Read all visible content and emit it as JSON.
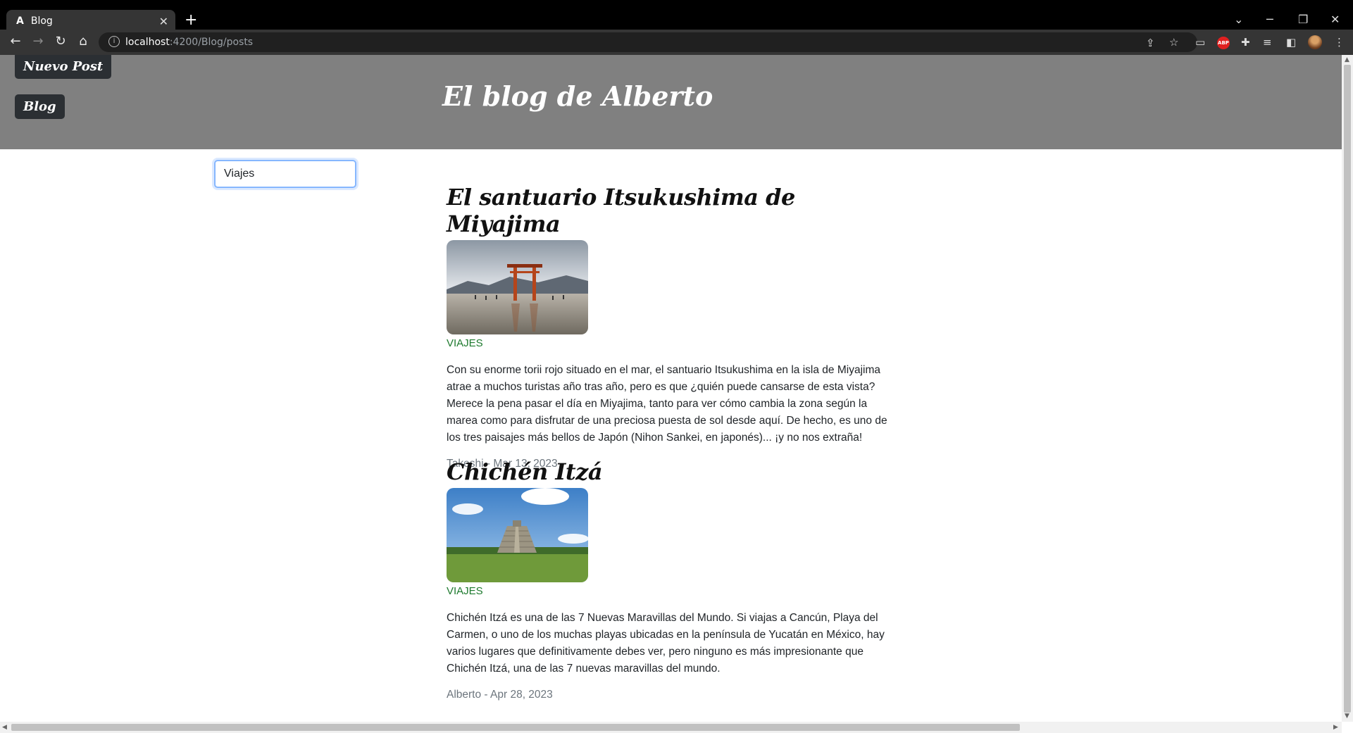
{
  "browser": {
    "tab_title": "Blog",
    "tab_favicon": "A",
    "url_host": "localhost",
    "url_path": ":4200/Blog/posts",
    "abp_label": "ABP"
  },
  "header": {
    "new_post_label": "Nuevo Post",
    "blog_label": "Blog",
    "site_title": "El blog de Alberto"
  },
  "search": {
    "value": "Viajes"
  },
  "posts": [
    {
      "title": "El santuario Itsukushima de Miyajima",
      "category": "VIAJES",
      "body": "Con su enorme torii rojo situado en el mar, el santuario Itsukushima en la isla de Miyajima atrae a muchos turistas año tras año, pero es que ¿quién puede cansarse de esta vista? Merece la pena pasar el día en Miyajima, tanto para ver cómo cambia la zona según la marea como para disfrutar de una preciosa puesta de sol desde aquí. De hecho, es uno de los tres paisajes más bellos de Japón (Nihon Sankei, en japonés)... ¡y no nos extraña!",
      "meta": "Takeshi - Mar 13, 2023"
    },
    {
      "title": "Chichén Itzá",
      "category": "VIAJES",
      "body": "Chichén Itzá es una de las 7 Nuevas Maravillas del Mundo. Si viajas a Cancún, Playa del Carmen, o uno de los muchas playas ubicadas en la península de Yucatán en México, hay varios lugares que definitivamente debes ver, pero ninguno es más impresionante que Chichén Itzá, una de las 7 nuevas maravillas del mundo.",
      "meta": "Alberto - Apr 28, 2023"
    }
  ]
}
